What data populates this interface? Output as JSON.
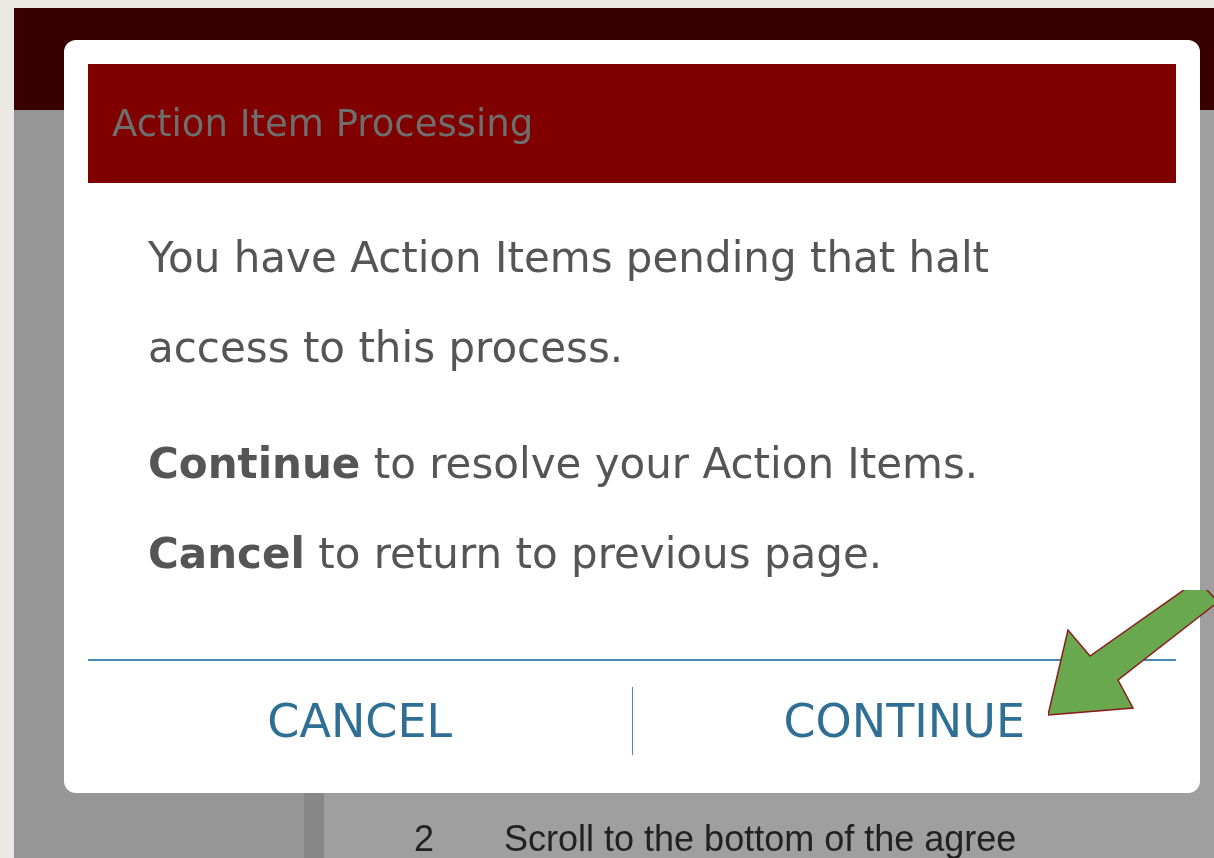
{
  "dialog": {
    "title": "Action Item Processing",
    "message": "You have Action Items pending that halt access to this process.",
    "instructions": [
      "**Continue** to resolve your Action Items.",
      "**Cancel** to return to previous page."
    ],
    "buttons": [
      {
        "label": "CANCEL"
      },
      {
        "label": "CONTINUE"
      }
    ]
  },
  "background": {
    "list_item": {
      "number": "2",
      "text": "Scroll to the bottom of the agree"
    }
  }
}
